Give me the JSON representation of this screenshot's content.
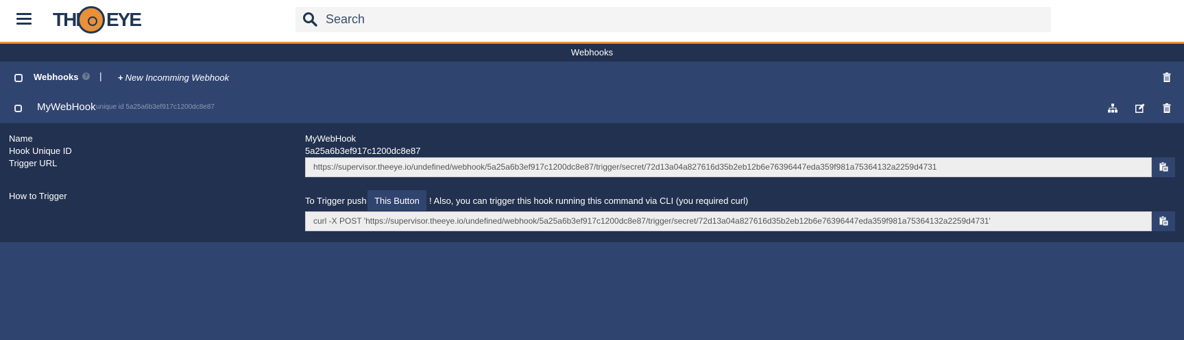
{
  "header": {
    "logo_text_left": "THE",
    "logo_text_right": "EYE",
    "search_placeholder": "Search"
  },
  "section": {
    "title": "Webhooks"
  },
  "toolbar": {
    "title": "Webhooks",
    "help_glyph": "?",
    "divider": "|",
    "new_webhook_label": "New Incomming Webhook"
  },
  "webhook": {
    "name": "MyWebHook",
    "unique_id_label": "unique id 5a25a6b3ef917c1200dc8e87"
  },
  "details": {
    "name_label": "Name",
    "name_value": "MyWebHook",
    "uid_label": "Hook Unique ID",
    "uid_value": "5a25a6b3ef917c1200dc8e87",
    "trigger_url_label": "Trigger URL",
    "trigger_url_value": "https://supervisor.theeye.io/undefined/webhook/5a25a6b3ef917c1200dc8e87/trigger/secret/72d13a04a827616d35b2eb12b6e76396447eda359f981a75364132a2259d4731",
    "how_label": "How to Trigger",
    "how_prefix": "To Trigger push",
    "this_button_label": "This Button",
    "how_suffix": "! Also, you can trigger this hook running this command via CLI (you required curl)",
    "curl_command": "curl -X POST 'https://supervisor.theeye.io/undefined/webhook/5a25a6b3ef917c1200dc8e87/trigger/secret/72d13a04a827616d35b2eb12b6e76396447eda359f981a75364132a2259d4731'"
  },
  "icons": {
    "menu": "hamburger-icon",
    "search": "search-icon",
    "help": "question-circle-icon",
    "plus": "plus-icon",
    "trash": "trash-icon",
    "workflow": "sitemap-icon",
    "edit": "edit-icon",
    "copy": "clipboard-icon"
  },
  "colors": {
    "brand_orange": "#e8903a",
    "navy": "#1e3654",
    "panel_bg": "#304470",
    "dark_bg": "#22314f"
  }
}
